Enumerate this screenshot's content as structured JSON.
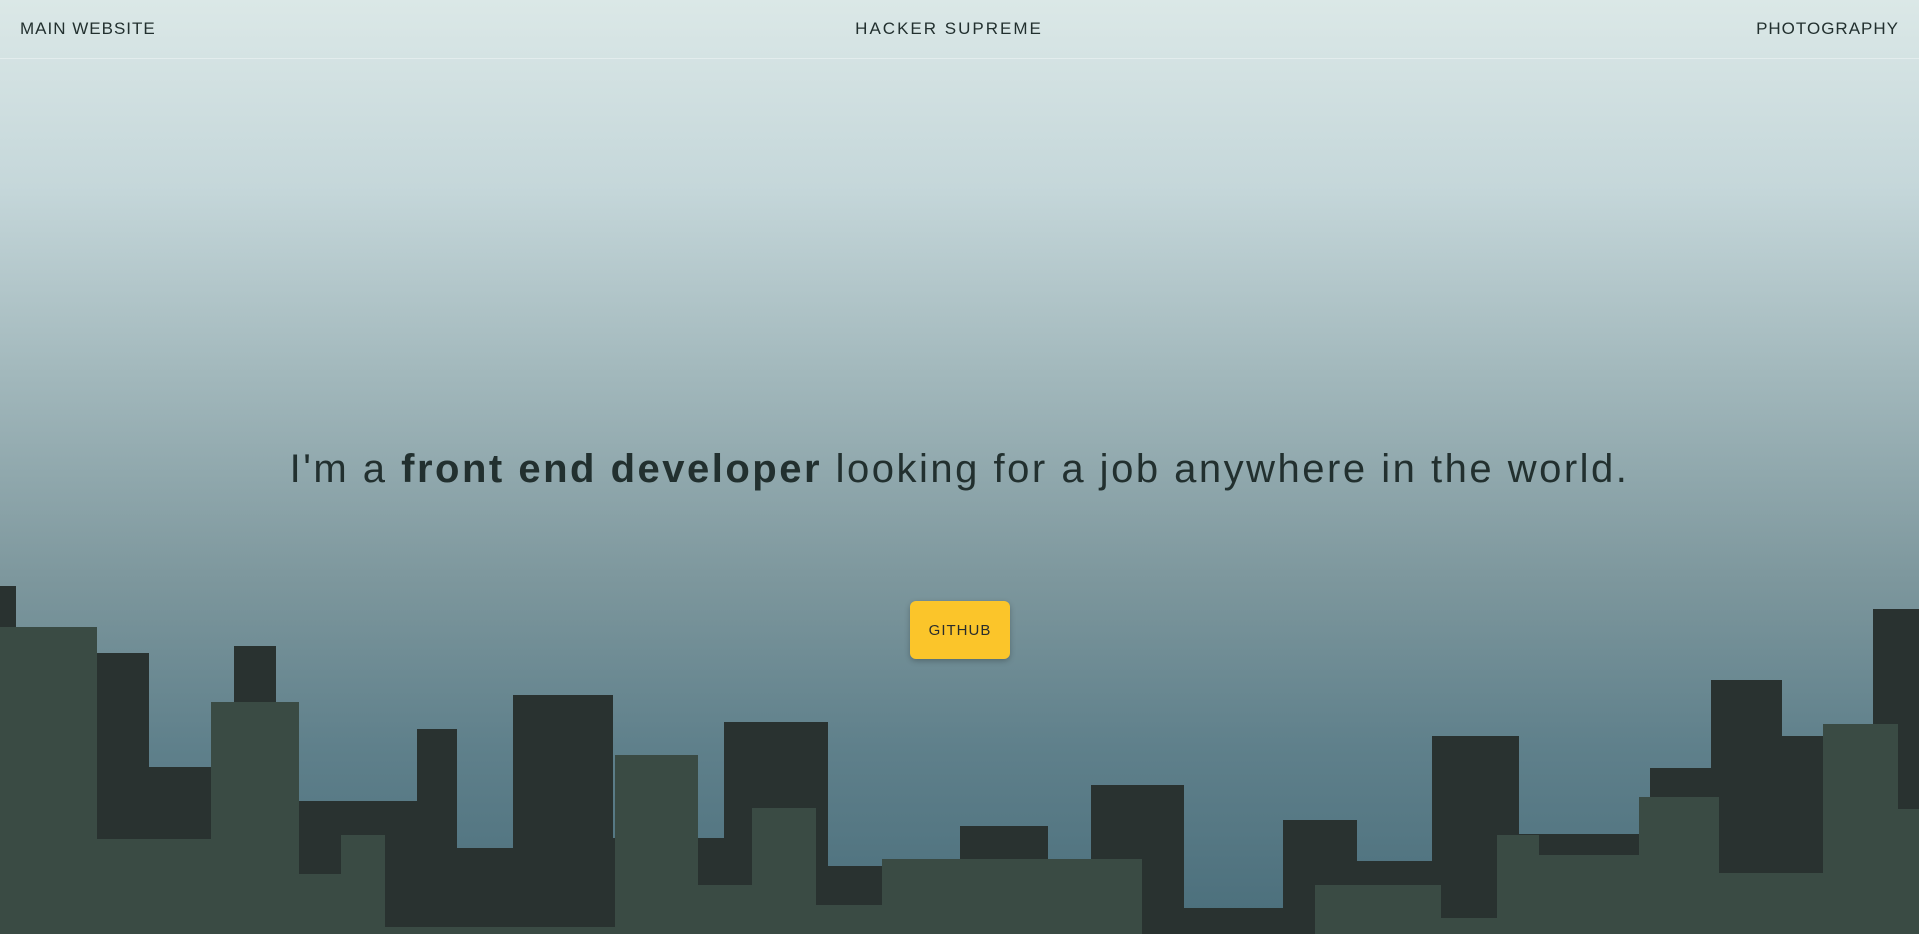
{
  "nav": {
    "main_website": "MAIN WEBSITE",
    "brand": "HACKER SUPREME",
    "photography": "PHOTOGRAPHY"
  },
  "hero": {
    "text_before": "I'm a ",
    "text_bold": "front end developer",
    "text_after": " looking for a job anywhere in the world."
  },
  "cta": {
    "github_label": "GITHUB"
  },
  "colors": {
    "button": "#fbc52a",
    "text": "#22302f",
    "building_dark": "#293230",
    "building_light": "#3a4b44"
  }
}
